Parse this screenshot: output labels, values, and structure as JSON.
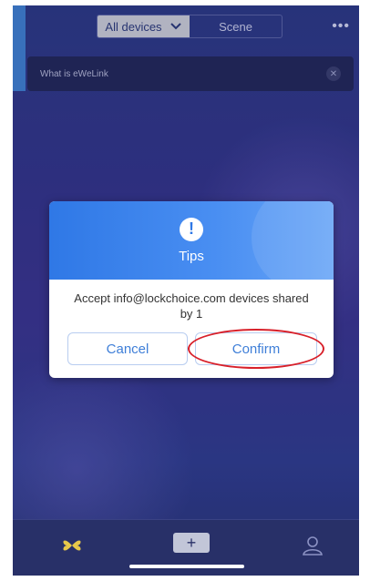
{
  "header": {
    "tabs": [
      {
        "label": "All devices",
        "active": true
      },
      {
        "label": "Scene",
        "active": false
      }
    ],
    "more_icon": "more-dots-icon"
  },
  "banner": {
    "text": "What is eWeLink",
    "close_icon": "close-icon"
  },
  "dialog": {
    "icon": "alert-icon",
    "icon_glyph": "!",
    "title": "Tips",
    "message": "Accept info@lockchoice.com devices shared by 1",
    "cancel_label": "Cancel",
    "confirm_label": "Confirm"
  },
  "bottom_nav": {
    "items": [
      {
        "icon": "devices-grid-icon"
      },
      {
        "icon": "add-icon",
        "glyph": "+"
      },
      {
        "icon": "profile-icon"
      }
    ]
  },
  "colors": {
    "accent": "#3f7fd8",
    "dialog_header": "#2f78e6",
    "highlight": "#d8202a",
    "background": "#33358a"
  }
}
